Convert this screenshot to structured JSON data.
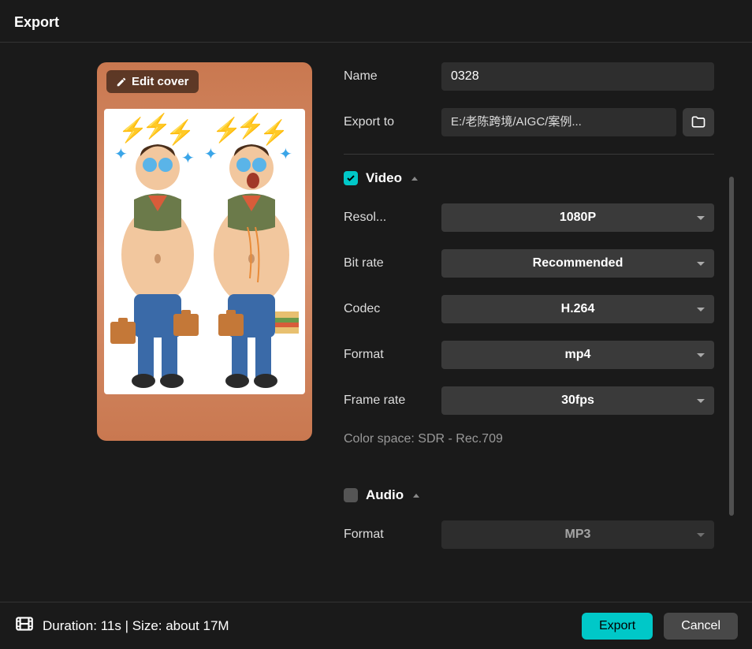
{
  "header": {
    "title": "Export"
  },
  "cover": {
    "edit_label": "Edit cover"
  },
  "fields": {
    "name_label": "Name",
    "name_value": "0328",
    "exportto_label": "Export to",
    "exportto_value": "E:/老陈跨境/AIGC/案例..."
  },
  "video": {
    "section_title": "Video",
    "enabled": true,
    "resolution_label": "Resol...",
    "resolution_value": "1080P",
    "bitrate_label": "Bit rate",
    "bitrate_value": "Recommended",
    "codec_label": "Codec",
    "codec_value": "H.264",
    "format_label": "Format",
    "format_value": "mp4",
    "framerate_label": "Frame rate",
    "framerate_value": "30fps",
    "colorspace_text": "Color space: SDR - Rec.709"
  },
  "audio": {
    "section_title": "Audio",
    "enabled": false,
    "format_label": "Format",
    "format_value": "MP3"
  },
  "footer": {
    "info_text": "Duration: 11s | Size: about 17M",
    "export_label": "Export",
    "cancel_label": "Cancel"
  }
}
